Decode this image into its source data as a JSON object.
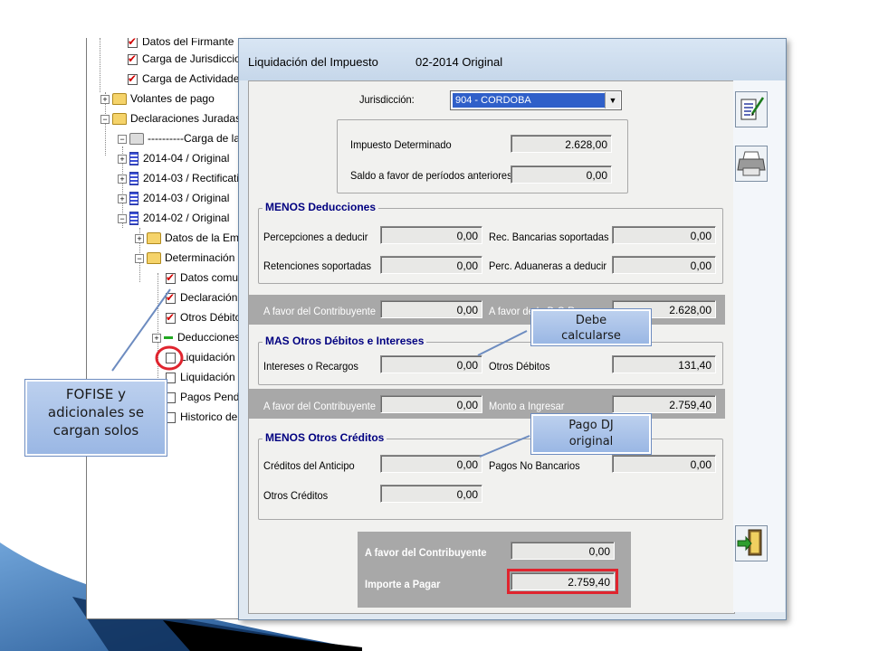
{
  "tree": {
    "items": [
      {
        "label": "Datos del Firmante"
      },
      {
        "label": "Carga de Jurisdiccio"
      },
      {
        "label": "Carga de Actividades"
      },
      {
        "label": "Volantes de pago"
      },
      {
        "label": "Declaraciones Juradas"
      },
      {
        "label": "----------Carga de las"
      },
      {
        "label": "2014-04 / Original"
      },
      {
        "label": "2014-03 / Rectificativ"
      },
      {
        "label": "2014-03 / Original"
      },
      {
        "label": "2014-02 / Original"
      },
      {
        "label": "Datos de la Empre"
      },
      {
        "label": "Determinación de"
      },
      {
        "label": "Datos comun"
      },
      {
        "label": "Declaración d"
      },
      {
        "label": "Otros Débitos"
      },
      {
        "label": "Deducciones"
      },
      {
        "label": "Liquidación p"
      },
      {
        "label": "Liquidación T"
      },
      {
        "label": "Pagos Pendie"
      },
      {
        "label": "Historico de P"
      }
    ]
  },
  "dialog": {
    "title": "Liquidación del Impuesto",
    "period": "02-2014 Original",
    "jurisdiccion_label": "Jurisdicción:",
    "jurisdiccion_value": "904 - CORDOBA",
    "impuesto_determinado_label": "Impuesto Determinado",
    "impuesto_determinado": "2.628,00",
    "saldo_favor_label": "Saldo a favor de períodos anteriores",
    "saldo_favor": "0,00",
    "menos_deducciones_title": "MENOS Deducciones",
    "percepciones_label": "Percepciones a deducir",
    "percepciones": "0,00",
    "rec_bancarias_label": "Rec. Bancarias soportadas",
    "rec_bancarias": "0,00",
    "retenciones_label": "Retenciones soportadas",
    "retenciones": "0,00",
    "perc_aduaneras_label": "Perc. Aduaneras a deducir",
    "perc_aduaneras": "0,00",
    "band1_left_label": "A favor del Contribuyente",
    "band1_left": "0,00",
    "band1_right_label": "A favor de la D.G.R.",
    "band1_right": "2.628,00",
    "mas_otros_title": "MAS Otros Débitos e Intereses",
    "intereses_label": "Intereses o Recargos",
    "intereses": "0,00",
    "otros_debitos_label": "Otros Débitos",
    "otros_debitos": "131,40",
    "band2_left_label": "A favor del Contribuyente",
    "band2_left": "0,00",
    "band2_right_label": "Monto a Ingresar",
    "band2_right": "2.759,40",
    "menos_otros_title": "MENOS Otros Créditos",
    "creditos_anticipo_label": "Créditos del Anticipo",
    "creditos_anticipo": "0,00",
    "pagos_no_bancarios_label": "Pagos No Bancarios",
    "pagos_no_bancarios": "0,00",
    "otros_creditos_label": "Otros Créditos",
    "otros_creditos": "0,00",
    "total_favor_label": "A favor del Contribuyente",
    "total_favor": "0,00",
    "importe_pagar_label": "Importe a Pagar",
    "importe_pagar": "2.759,40"
  },
  "callouts": {
    "fofise": "FOFISE y adicionales se cargan solos",
    "debe": "Debe calcularse",
    "pago": "Pago DJ original"
  },
  "icons": {
    "edit": "edit-document-icon",
    "print": "printer-icon",
    "exit": "exit-door-icon"
  },
  "colors": {
    "highlight_border": "#e0242e",
    "group_title": "#000080",
    "band": "#a8a8a8"
  }
}
